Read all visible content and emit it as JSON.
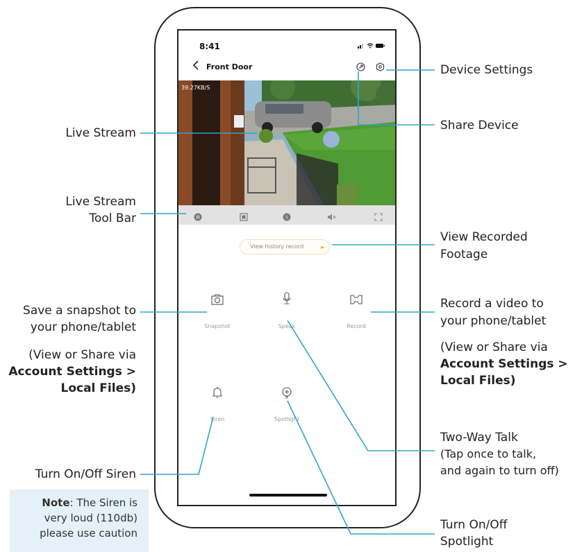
{
  "colors": {
    "leader": "#2aa7c9",
    "note_bg": "#e4f1f8",
    "pill_dot": "#f0b323"
  },
  "phone": {
    "status_time": "8:41",
    "title": "Front Door",
    "bitrate": "39.27KB/S",
    "history_button": "View history record",
    "actions": {
      "snapshot": "Snapshot",
      "speak": "Speak",
      "record": "Record",
      "siren": "Siren",
      "spotlight": "Spotlight"
    },
    "icons": [
      "back-icon",
      "share-icon",
      "settings-icon",
      "pause-icon",
      "stop-icon",
      "hd-icon",
      "mute-icon",
      "fullscreen-icon",
      "camera-icon",
      "microphone-icon",
      "video-icon",
      "bell-icon",
      "light-bulb-icon"
    ]
  },
  "callouts": {
    "device_settings": "Device Settings",
    "share_device": "Share Device",
    "live_stream": "Live Stream",
    "toolbar_line1": "Live Stream",
    "toolbar_line2": "Tool Bar",
    "view_recorded_line1": "View Recorded",
    "view_recorded_line2": "Footage",
    "snapshot_line1": "Save a snapshot to",
    "snapshot_line2": "your phone/tablet",
    "snapshot_note_line1": "(View or Share via",
    "snapshot_note_bold1": "Account Settings >",
    "snapshot_note_bold2": "Local Files)",
    "record_line1": "Record a video to",
    "record_line2": "your phone/tablet",
    "record_note_line1": "(View or Share via",
    "record_note_bold1": "Account Settings >",
    "record_note_bold2": "Local Files)",
    "two_way_line1": "Two-Way Talk",
    "two_way_line2": "(Tap once to talk,",
    "two_way_line3": "and again to turn off)",
    "siren": "Turn On/Off Siren",
    "spotlight_line1": "Turn On/Off",
    "spotlight_line2": "Spotlight",
    "note_bold": "Note",
    "note_rest": ": The Siren is",
    "note_line2": "very loud (110db)",
    "note_line3": "please use caution"
  }
}
